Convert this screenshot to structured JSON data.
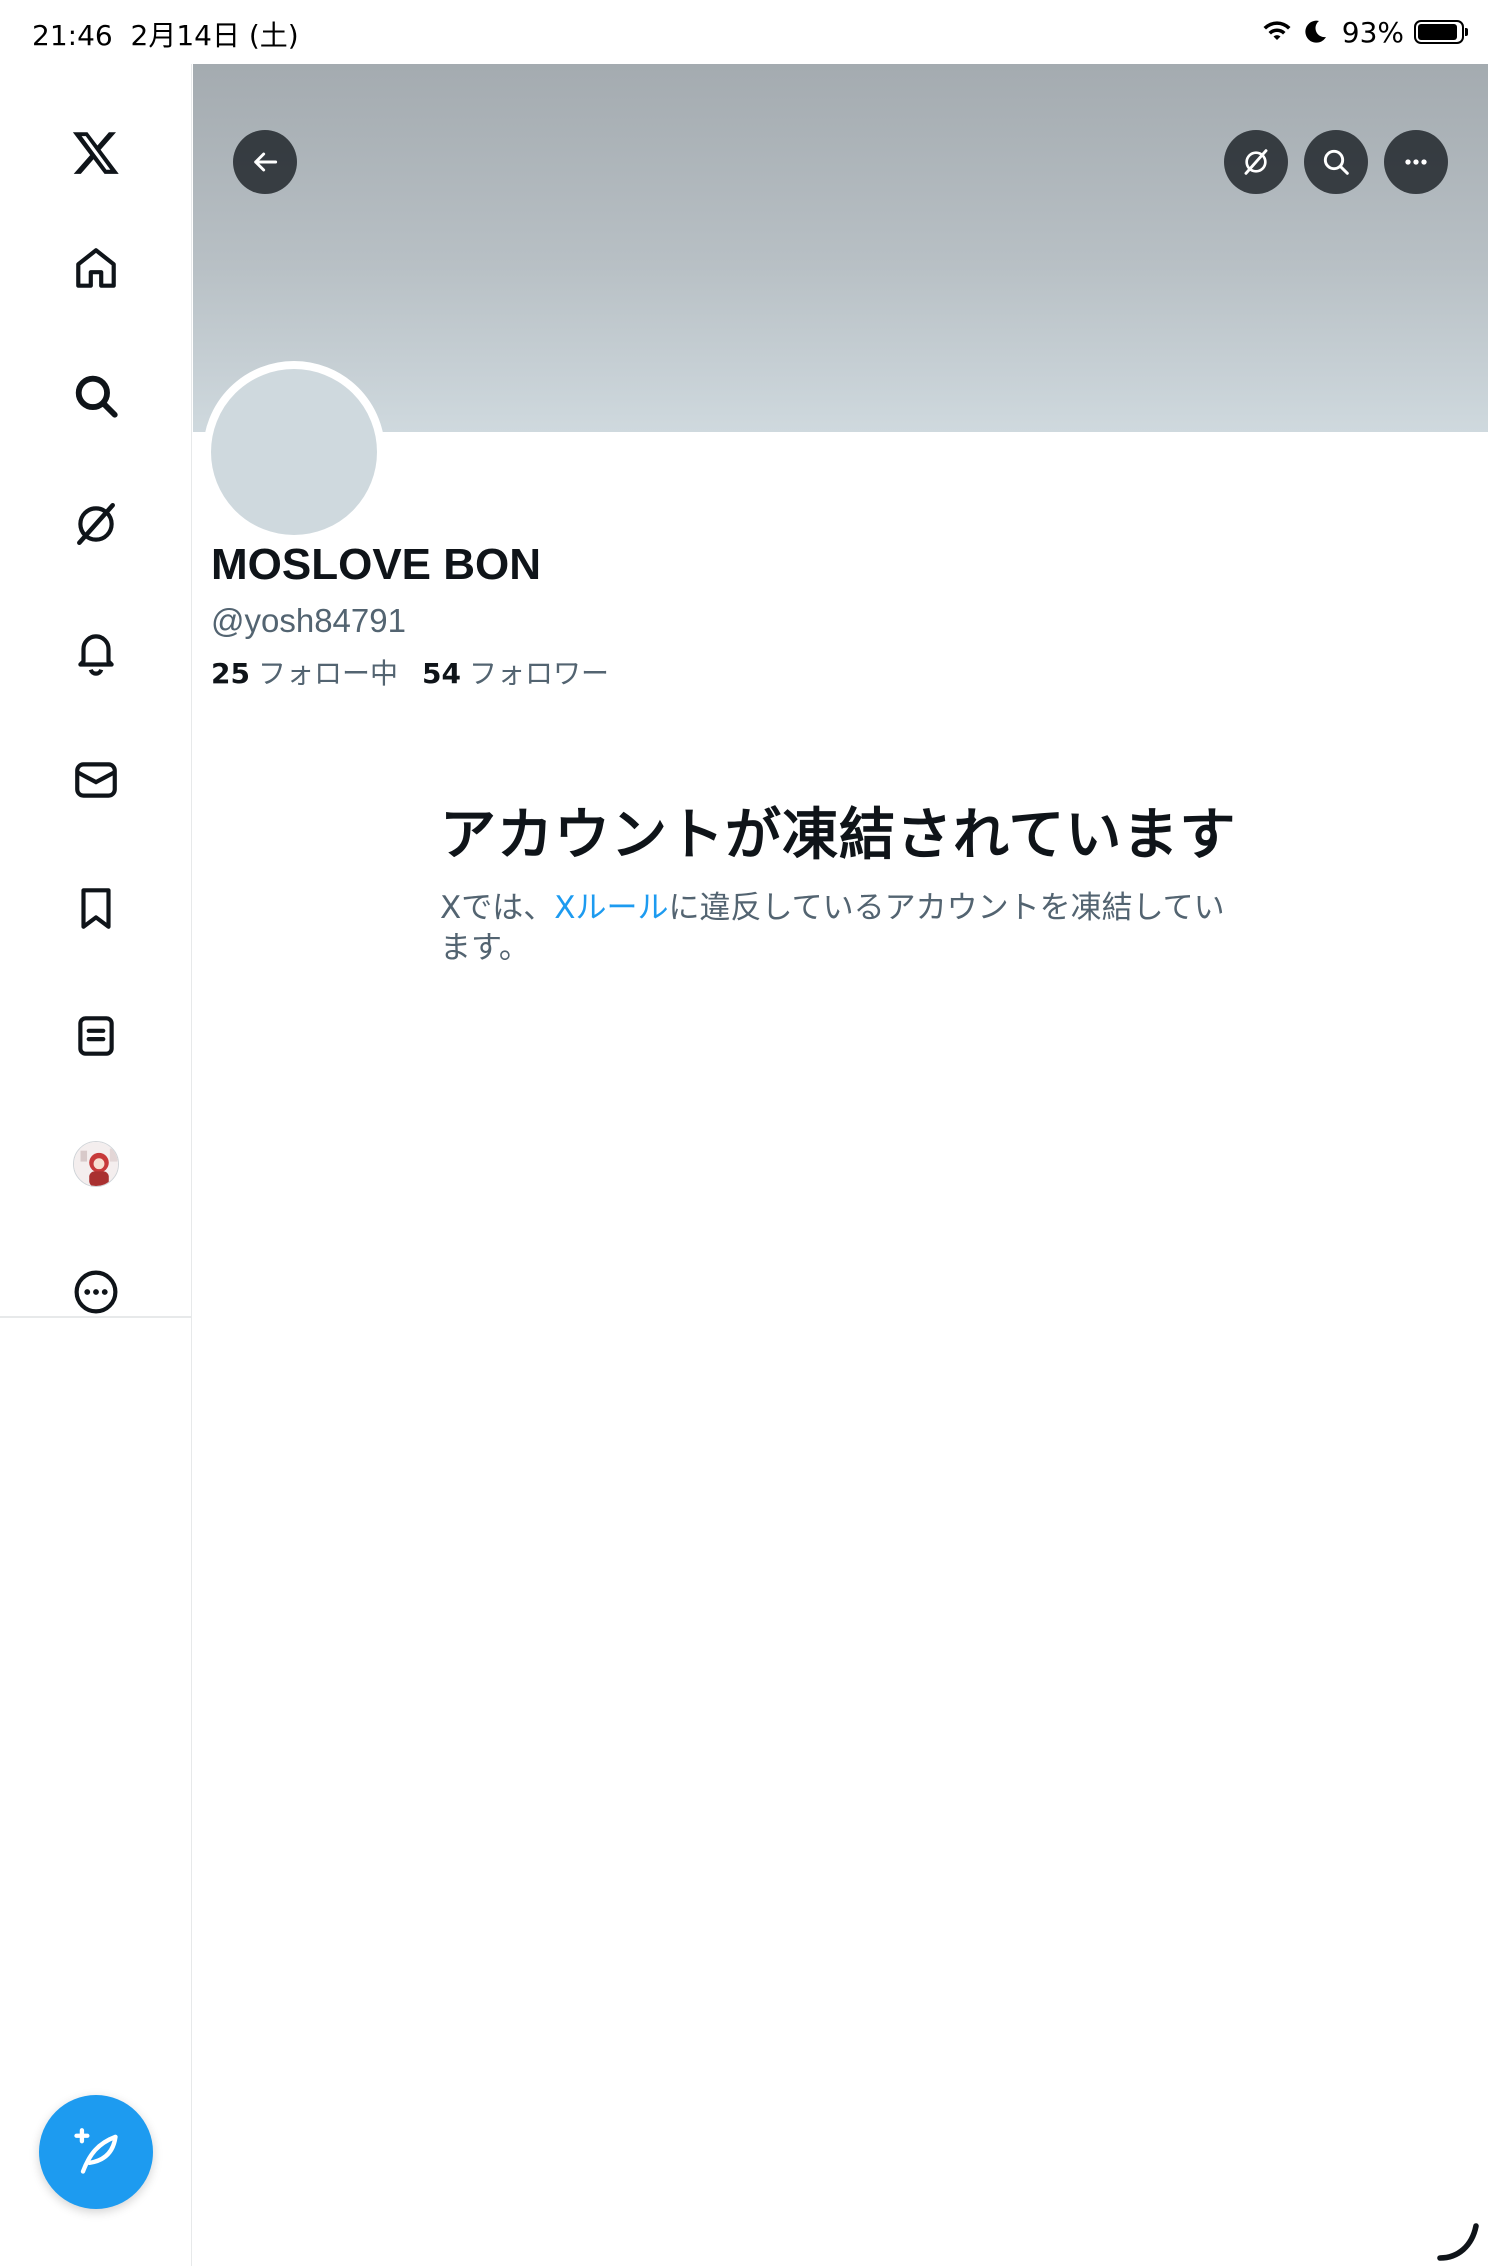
{
  "status_bar": {
    "time": "21:46",
    "date": "2月14日 (土)",
    "battery_percent": "93%",
    "battery_level": 0.93
  },
  "sidebar": {
    "items": [
      {
        "name": "x-logo-icon"
      },
      {
        "name": "home-icon"
      },
      {
        "name": "search-icon"
      },
      {
        "name": "grok-icon"
      },
      {
        "name": "notifications-icon"
      },
      {
        "name": "messages-icon"
      },
      {
        "name": "bookmarks-icon"
      },
      {
        "name": "lists-icon"
      },
      {
        "name": "profile-avatar-icon"
      },
      {
        "name": "more-icon"
      }
    ],
    "compose_icon": "compose-post-icon"
  },
  "header": {
    "back_icon": "back-arrow-icon",
    "grok_icon": "grok-icon",
    "search_icon": "search-icon",
    "more_icon": "more-options-icon"
  },
  "profile": {
    "display_name": "MOSLOVE BON",
    "handle": "@yosh84791",
    "following_count": "25",
    "following_label": "フォロー中",
    "followers_count": "54",
    "followers_label": "フォロワー"
  },
  "notice": {
    "title": "アカウントが凍結されています",
    "body_prefix": "Xでは、",
    "rules_link": "Xルール",
    "body_suffix": "に違反しているアカウントを凍結しています。"
  },
  "colors": {
    "accent": "#1d9bf0",
    "text_primary": "#0f1419",
    "text_secondary": "#536471",
    "banner": "#b8c0c5"
  }
}
